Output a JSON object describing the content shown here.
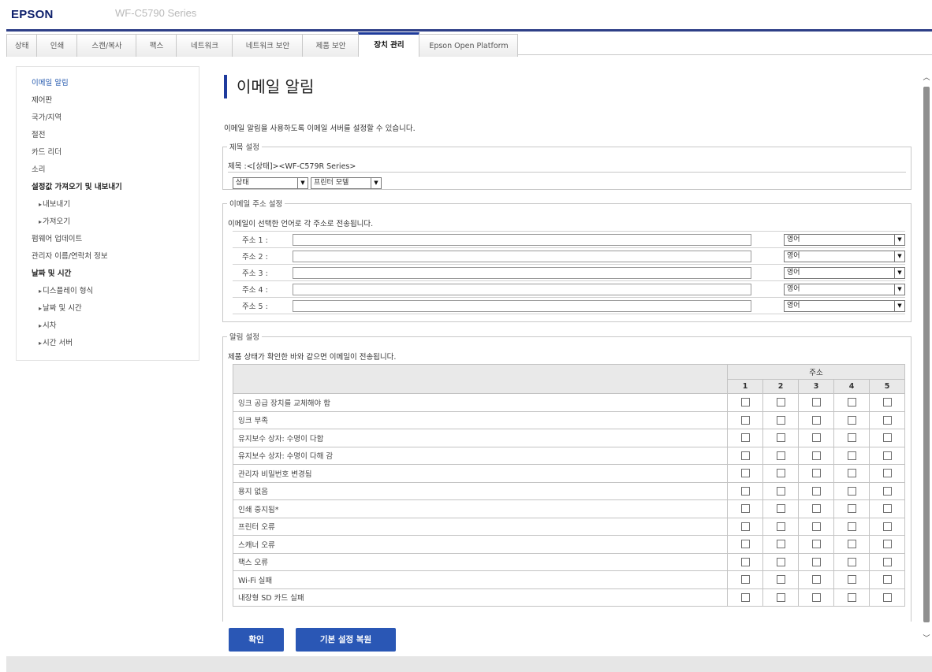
{
  "header": {
    "logo": "EPSON",
    "model": "WF-C5790 Series"
  },
  "tabs": [
    "상태",
    "인쇄",
    "스캔/복사",
    "팩스",
    "네트워크",
    "네트워크 보안",
    "제품 보안",
    "장치 관리",
    "Epson Open Platform"
  ],
  "active_tab": "장치 관리",
  "sidebar": {
    "items": [
      {
        "label": "이메일 알림"
      },
      {
        "label": "제어판"
      },
      {
        "label": "국가/지역"
      },
      {
        "label": "절전"
      },
      {
        "label": "카드 리더"
      },
      {
        "label": "소리"
      },
      {
        "label": "설정값 가져오기 및 내보내기"
      },
      {
        "label": "내보내기"
      },
      {
        "label": "가져오기"
      },
      {
        "label": "펌웨어 업데이트"
      },
      {
        "label": "관리자 이름/연락처 정보"
      },
      {
        "label": "날짜 및 시간"
      },
      {
        "label": "디스플레이 형식"
      },
      {
        "label": "날짜 및 시간"
      },
      {
        "label": "시차"
      },
      {
        "label": "시간 서버"
      }
    ]
  },
  "main": {
    "title": "이메일 알림",
    "description": "이메일 알림을 사용하도록 이메일 서버를 설정할 수 있습니다.",
    "subject": {
      "legend": "제목 설정",
      "text": "제목 :<[상태]><WF-C579R Series>",
      "select1": "상태",
      "select2": "프린터 모델"
    },
    "email": {
      "legend": "이메일 주소 설정",
      "description": "이메일이 선택한 언어로 각 주소로 전송됩니다.",
      "addresses": [
        {
          "label": "주소 1 :",
          "value": "",
          "lang": "영어"
        },
        {
          "label": "주소 2 :",
          "value": "",
          "lang": "영어"
        },
        {
          "label": "주소 3 :",
          "value": "",
          "lang": "영어"
        },
        {
          "label": "주소 4 :",
          "value": "",
          "lang": "영어"
        },
        {
          "label": "주소 5 :",
          "value": "",
          "lang": "영어"
        }
      ]
    },
    "notify": {
      "legend": "알림 설정",
      "description": "제품 상태가 확인한 바와 같으면 이메일이 전송됩니다.",
      "address_header": "주소",
      "columns": [
        "1",
        "2",
        "3",
        "4",
        "5"
      ],
      "events": [
        "잉크 공급 장치를 교체해야 함",
        "잉크 부족",
        "유지보수 상자: 수명이 다함",
        "유지보수 상자: 수명이 다해 감",
        "관리자 비밀번호 변경됨",
        "용지 없음",
        "인쇄 중지됨*",
        "프린터 오류",
        "스캐너 오류",
        "팩스 오류",
        "Wi-Fi 실패",
        "내장형 SD 카드 실패"
      ]
    }
  },
  "buttons": {
    "ok": "확인",
    "restore": "기본 설정 복원"
  },
  "colors": {
    "accent": "#2a57b5",
    "tab_accent": "#2e3f87",
    "title_bar": "#1f3b9d"
  }
}
